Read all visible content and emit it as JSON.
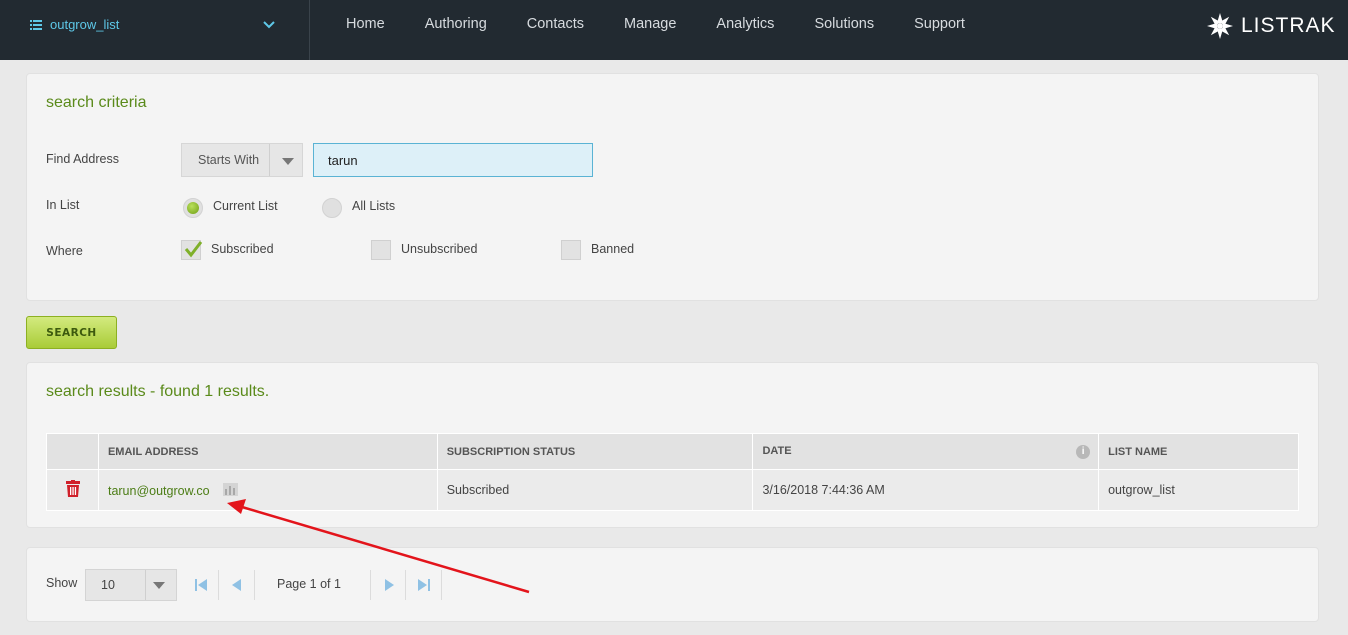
{
  "topbar": {
    "list_name": "outgrow_list",
    "nav": [
      "Home",
      "Authoring",
      "Contacts",
      "Manage",
      "Analytics",
      "Solutions",
      "Support"
    ],
    "logo_text": "LISTRAK"
  },
  "criteria": {
    "title": "search criteria",
    "find_label": "Find Address",
    "match_mode": "Starts With",
    "query": "tarun",
    "in_list_label": "In List",
    "radio_current": "Current List",
    "radio_all": "All Lists",
    "where_label": "Where",
    "cb_subscribed": "Subscribed",
    "cb_unsubscribed": "Unsubscribed",
    "cb_banned": "Banned"
  },
  "search_button": "SEARCH",
  "results": {
    "title": "search results - found 1 results.",
    "columns": [
      "EMAIL ADDRESS",
      "SUBSCRIPTION STATUS",
      "DATE",
      "LIST NAME"
    ],
    "rows": [
      {
        "email": "tarun@outgrow.co",
        "status": "Subscribed",
        "date": "3/16/2018 7:44:36 AM",
        "list": "outgrow_list"
      }
    ]
  },
  "pager": {
    "show_label": "Show",
    "page_size": "10",
    "page_text": "Page 1 of 1"
  },
  "colors": {
    "topbar": "#222a31",
    "accent_green": "#5a8a1a",
    "annotation_arrow": "#e3141b"
  }
}
